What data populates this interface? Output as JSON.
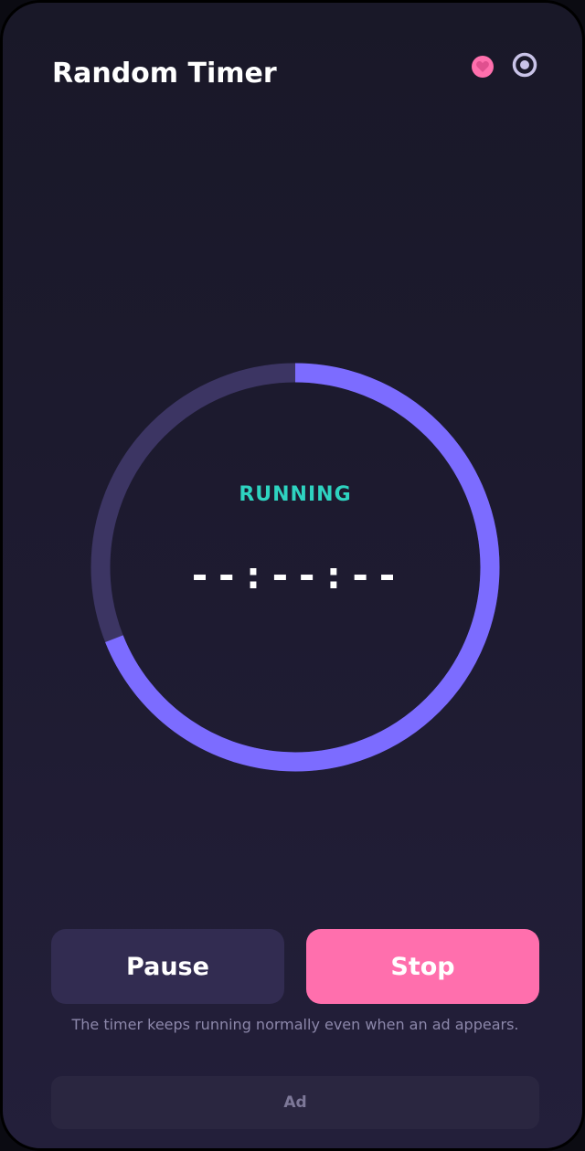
{
  "app": {
    "title": "Random Timer"
  },
  "header_icons": [
    {
      "name": "heart-icon",
      "color": "#ff6fad"
    },
    {
      "name": "target-icon",
      "color": "#c9c3e8"
    }
  ],
  "timer": {
    "status": "RUNNING",
    "display": "--:--:--",
    "progress": 0.69,
    "colors": {
      "progress": "#7c6cff",
      "track": "#3c3563",
      "status": "#2ed3c0"
    }
  },
  "controls": {
    "pause_label": "Pause",
    "stop_label": "Stop"
  },
  "hint": "The timer keeps running normally even when an ad appears.",
  "ad": {
    "label": "Ad"
  }
}
